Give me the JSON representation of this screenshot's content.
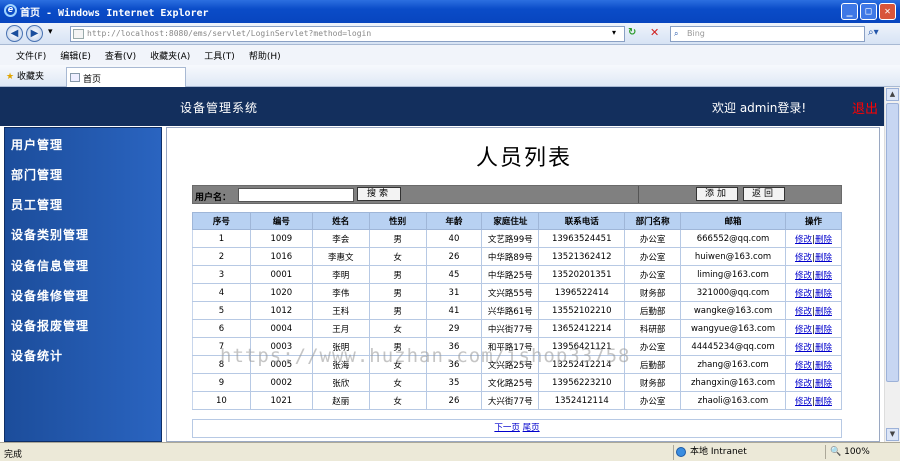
{
  "window": {
    "title": "首页 - Windows Internet Explorer"
  },
  "browser": {
    "address": "http://localhost:8080/ems/servlet/LoginServlet?method=login",
    "search_placeholder": "Bing",
    "menu": [
      "文件(F)",
      "编辑(E)",
      "查看(V)",
      "收藏夹(A)",
      "工具(T)",
      "帮助(H)"
    ],
    "favorites_label": "收藏夹",
    "tab_label": "首页",
    "status_text": "完成",
    "zone_text": "本地 Intranet",
    "zoom_text": "100%"
  },
  "header": {
    "app_title": "设备管理系统",
    "welcome": "欢迎 admin登录!",
    "logout": "退出"
  },
  "sidebar": {
    "items": [
      "用户管理",
      "部门管理",
      "员工管理",
      "设备类别管理",
      "设备信息管理",
      "设备维修管理",
      "设备报废管理",
      "设备统计"
    ]
  },
  "main": {
    "title": "人员列表",
    "search_label": "用户名：",
    "search_button": "搜索",
    "add_button": "添加",
    "back_button": "返回",
    "columns": [
      "序号",
      "编号",
      "姓名",
      "性别",
      "年龄",
      "家庭住址",
      "联系电话",
      "部门名称",
      "邮箱",
      "操作"
    ],
    "rows": [
      [
        "1",
        "1009",
        "李会",
        "男",
        "40",
        "文艺路99号",
        "13963524451",
        "办公室",
        "666552@qq.com"
      ],
      [
        "2",
        "1016",
        "李惠文",
        "女",
        "26",
        "中华路89号",
        "13521362412",
        "办公室",
        "huiwen@163.com"
      ],
      [
        "3",
        "0001",
        "李明",
        "男",
        "45",
        "中华路25号",
        "13520201351",
        "办公室",
        "liming@163.com"
      ],
      [
        "4",
        "1020",
        "李伟",
        "男",
        "31",
        "文兴路55号",
        "1396522414",
        "财务部",
        "321000@qq.com"
      ],
      [
        "5",
        "1012",
        "王科",
        "男",
        "41",
        "兴华路61号",
        "13552102210",
        "后勤部",
        "wangke@163.com"
      ],
      [
        "6",
        "0004",
        "王月",
        "女",
        "29",
        "中兴街77号",
        "13652412214",
        "科研部",
        "wangyue@163.com"
      ],
      [
        "7",
        "0003",
        "张明",
        "男",
        "36",
        "和平路17号",
        "13956421121",
        "办公室",
        "44445234@qq.com"
      ],
      [
        "8",
        "0005",
        "张海",
        "女",
        "36",
        "文兴路25号",
        "13252412214",
        "后勤部",
        "zhang@163.com"
      ],
      [
        "9",
        "0002",
        "张欣",
        "女",
        "35",
        "文化路25号",
        "13956223210",
        "财务部",
        "zhangxin@163.com"
      ],
      [
        "10",
        "1021",
        "赵丽",
        "女",
        "26",
        "大兴街77号",
        "1352412114",
        "办公室",
        "zhaoli@163.com"
      ]
    ],
    "edit_label": "修改",
    "delete_label": "删除",
    "next_page": "下一页",
    "last_page": "尾页"
  },
  "watermark": "https://www.huzhan.com/ishop33758"
}
